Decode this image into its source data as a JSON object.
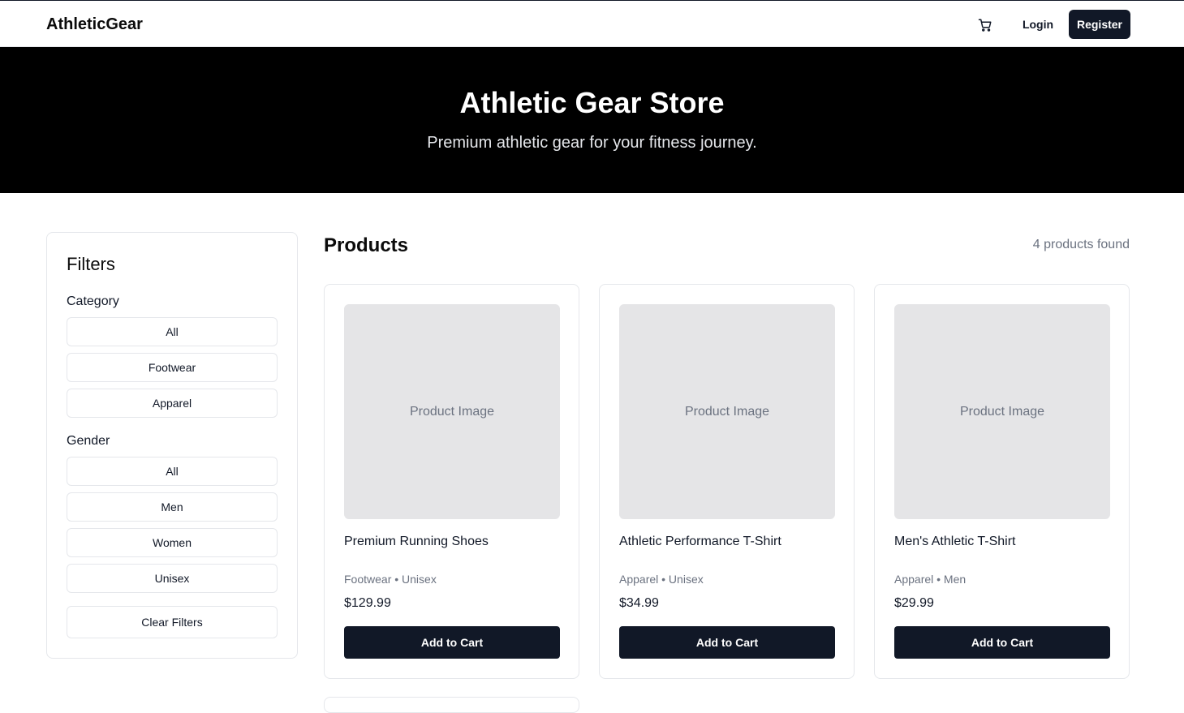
{
  "navbar": {
    "brand": "AthleticGear",
    "cart_icon": "shopping-cart-icon",
    "login_label": "Login",
    "register_label": "Register"
  },
  "hero": {
    "title": "Athletic Gear Store",
    "subtitle": "Premium athletic gear for your fitness journey."
  },
  "filters": {
    "title": "Filters",
    "category": {
      "title": "Category",
      "options": [
        "All",
        "Footwear",
        "Apparel"
      ]
    },
    "gender": {
      "title": "Gender",
      "options": [
        "All",
        "Men",
        "Women",
        "Unisex"
      ]
    },
    "clear_label": "Clear Filters"
  },
  "products": {
    "title": "Products",
    "count_text": "4 products found",
    "items": [
      {
        "image_placeholder": "Product Image",
        "name": "Premium Running Shoes",
        "meta": "Footwear • Unisex",
        "price": "$129.99",
        "button_label": "Add to Cart"
      },
      {
        "image_placeholder": "Product Image",
        "name": "Athletic Performance T-Shirt",
        "meta": "Apparel • Unisex",
        "price": "$34.99",
        "button_label": "Add to Cart"
      },
      {
        "image_placeholder": "Product Image",
        "name": "Men's Athletic T-Shirt",
        "meta": "Apparel • Men",
        "price": "$29.99",
        "button_label": "Add to Cart"
      }
    ]
  },
  "colors": {
    "primary": "#111827",
    "hero_bg": "#000000",
    "muted_text": "#6b7280",
    "image_placeholder_bg": "#e5e5e7",
    "border": "#e5e7eb"
  }
}
